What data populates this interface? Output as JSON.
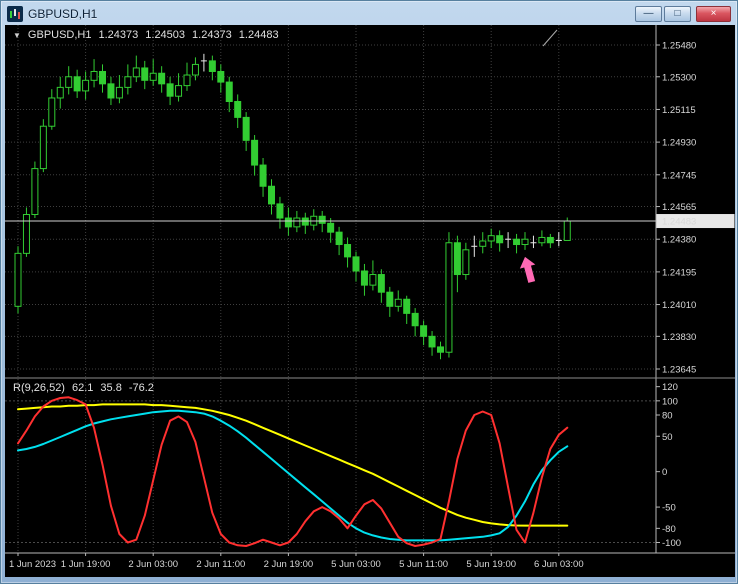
{
  "window": {
    "title": "GBPUSD,H1",
    "controls": {
      "minimize_glyph": "—",
      "maximize_glyph": "□",
      "close_glyph": "×"
    }
  },
  "icons": {
    "app_icon": "candlestick-chart-icon",
    "dropdown_marker": "▼"
  },
  "chart_header": {
    "symbol": "GBPUSD,H1",
    "open": "1.24373",
    "high": "1.24503",
    "low": "1.24373",
    "close": "1.24483"
  },
  "indicator_header": {
    "name": "R(9,26,52)",
    "v1": "62.1",
    "v2": "35.8",
    "v3": "-76.2"
  },
  "colors": {
    "background": "#000000",
    "grid": "#3f3f3f",
    "axis": "#b8b8b8",
    "text": "#d8d8d8",
    "candle": "#32CD32",
    "doji": "#e8e8e8",
    "bid_line": "#d0d0d0",
    "bid_tag_bg": "#e8e8e8",
    "red_line": "#ff3030",
    "cyan_line": "#00e0ee",
    "yellow_line": "#ffff00",
    "arrow": "#ff69b4",
    "titlebar": "#a9c7e2",
    "close_button": "#bf3642"
  },
  "chart_data": {
    "type": "candlestick",
    "symbol": "GBPUSD",
    "timeframe": "H1",
    "price_axis": {
      "ticks": [
        "1.25480",
        "1.25300",
        "1.25115",
        "1.24930",
        "1.24745",
        "1.24565",
        "1.24380",
        "1.24195",
        "1.24010",
        "1.23830",
        "1.23645"
      ],
      "current": "1.24483"
    },
    "time_axis": {
      "labels": [
        "1 Jun 2023",
        "1 Jun 19:00",
        "2 Jun 03:00",
        "2 Jun 11:00",
        "2 Jun 19:00",
        "5 Jun 03:00",
        "5 Jun 11:00",
        "5 Jun 19:00",
        "6 Jun 03:00"
      ],
      "bar_indices": [
        0,
        8,
        16,
        24,
        32,
        40,
        48,
        56,
        64
      ]
    },
    "candles": [
      [
        1.24,
        1.2434,
        1.2396,
        1.243
      ],
      [
        1.243,
        1.2456,
        1.2428,
        1.2452
      ],
      [
        1.2452,
        1.2482,
        1.245,
        1.2478
      ],
      [
        1.2478,
        1.2506,
        1.2476,
        1.2502
      ],
      [
        1.2502,
        1.2523,
        1.25,
        1.2518
      ],
      [
        1.2518,
        1.253,
        1.2512,
        1.2524
      ],
      [
        1.2524,
        1.2536,
        1.252,
        1.253
      ],
      [
        1.253,
        1.2534,
        1.2518,
        1.2522
      ],
      [
        1.2522,
        1.2533,
        1.2517,
        1.2528
      ],
      [
        1.2528,
        1.254,
        1.2524,
        1.2533
      ],
      [
        1.2533,
        1.2537,
        1.2521,
        1.2526
      ],
      [
        1.2526,
        1.253,
        1.2514,
        1.2518
      ],
      [
        1.2518,
        1.2531,
        1.2515,
        1.2524
      ],
      [
        1.2524,
        1.2537,
        1.252,
        1.253
      ],
      [
        1.253,
        1.2542,
        1.2527,
        1.2535
      ],
      [
        1.2535,
        1.2539,
        1.2523,
        1.2528
      ],
      [
        1.2528,
        1.254,
        1.2525,
        1.2532
      ],
      [
        1.2532,
        1.2536,
        1.2521,
        1.2526
      ],
      [
        1.2526,
        1.253,
        1.2514,
        1.2519
      ],
      [
        1.2519,
        1.2532,
        1.2516,
        1.2525
      ],
      [
        1.2525,
        1.2538,
        1.2522,
        1.2531
      ],
      [
        1.2531,
        1.2541,
        1.2528,
        1.2537
      ],
      [
        1.2537,
        1.2543,
        1.2533,
        1.2539
      ],
      [
        1.2539,
        1.2542,
        1.2528,
        1.2533
      ],
      [
        1.2533,
        1.2537,
        1.2521,
        1.2527
      ],
      [
        1.2527,
        1.253,
        1.251,
        1.2516
      ],
      [
        1.2516,
        1.252,
        1.2501,
        1.2507
      ],
      [
        1.2507,
        1.251,
        1.2488,
        1.2494
      ],
      [
        1.2494,
        1.2497,
        1.2474,
        1.248
      ],
      [
        1.248,
        1.2484,
        1.2462,
        1.2468
      ],
      [
        1.2468,
        1.2472,
        1.2452,
        1.2458
      ],
      [
        1.2458,
        1.2462,
        1.2444,
        1.245
      ],
      [
        1.245,
        1.2456,
        1.244,
        1.2445
      ],
      [
        1.2445,
        1.2454,
        1.2442,
        1.245
      ],
      [
        1.245,
        1.2453,
        1.2441,
        1.2446
      ],
      [
        1.2446,
        1.2455,
        1.2443,
        1.2451
      ],
      [
        1.2451,
        1.2454,
        1.2442,
        1.2447
      ],
      [
        1.2447,
        1.245,
        1.2436,
        1.2442
      ],
      [
        1.2442,
        1.2445,
        1.2429,
        1.2435
      ],
      [
        1.2435,
        1.2439,
        1.2422,
        1.2428
      ],
      [
        1.2428,
        1.2431,
        1.2414,
        1.242
      ],
      [
        1.242,
        1.2424,
        1.2406,
        1.2412
      ],
      [
        1.2412,
        1.2426,
        1.2409,
        1.2418
      ],
      [
        1.2418,
        1.2421,
        1.2402,
        1.2408
      ],
      [
        1.2408,
        1.2411,
        1.2394,
        1.24
      ],
      [
        1.24,
        1.2409,
        1.2397,
        1.2404
      ],
      [
        1.2404,
        1.2406,
        1.239,
        1.2396
      ],
      [
        1.2396,
        1.2399,
        1.2383,
        1.2389
      ],
      [
        1.2389,
        1.2392,
        1.2378,
        1.2383
      ],
      [
        1.2383,
        1.2386,
        1.2372,
        1.2377
      ],
      [
        1.2377,
        1.238,
        1.237,
        1.2374
      ],
      [
        1.2374,
        1.2442,
        1.2371,
        1.2436
      ],
      [
        1.2436,
        1.244,
        1.2408,
        1.2418
      ],
      [
        1.2418,
        1.2436,
        1.2415,
        1.2432
      ],
      [
        1.2432,
        1.244,
        1.2428,
        1.2434
      ],
      [
        1.2434,
        1.2442,
        1.243,
        1.2437
      ],
      [
        1.2437,
        1.2444,
        1.2433,
        1.244
      ],
      [
        1.244,
        1.2443,
        1.2431,
        1.2436
      ],
      [
        1.2436,
        1.2442,
        1.2433,
        1.2438
      ],
      [
        1.2438,
        1.2441,
        1.243,
        1.2435
      ],
      [
        1.2435,
        1.2442,
        1.2432,
        1.2438
      ],
      [
        1.2438,
        1.244,
        1.2433,
        1.2436
      ],
      [
        1.2436,
        1.2443,
        1.2434,
        1.2439
      ],
      [
        1.2439,
        1.2441,
        1.2433,
        1.2436
      ],
      [
        1.2436,
        1.2442,
        1.2434,
        1.24373
      ],
      [
        1.24373,
        1.24503,
        1.24373,
        1.24483
      ]
    ],
    "indicator": {
      "name": "R(9,26,52)",
      "last_values": [
        62.1,
        35.8,
        -76.2
      ],
      "ticks": [
        "120",
        "100",
        "80",
        "50",
        "0",
        "-50",
        "-80",
        "-100"
      ],
      "levels": [
        100,
        -100
      ],
      "series": [
        {
          "name": "fast",
          "color": "#ff3030",
          "values": [
            40,
            58,
            78,
            92,
            100,
            104,
            105,
            101,
            95,
            62,
            10,
            -48,
            -88,
            -100,
            -96,
            -62,
            -12,
            38,
            72,
            78,
            70,
            42,
            -8,
            -58,
            -88,
            -100,
            -104,
            -105,
            -101,
            -96,
            -100,
            -104,
            -100,
            -88,
            -70,
            -56,
            -50,
            -56,
            -66,
            -80,
            -62,
            -46,
            -40,
            -52,
            -72,
            -92,
            -101,
            -105,
            -103,
            -100,
            -95,
            -42,
            18,
            58,
            80,
            85,
            80,
            40,
            -22,
            -82,
            -100,
            -58,
            -8,
            32,
            52,
            62.1
          ]
        },
        {
          "name": "mid",
          "color": "#00e0ee",
          "values": [
            30,
            32,
            35,
            39,
            44,
            49,
            54,
            59,
            64,
            68,
            71,
            74,
            76,
            78,
            80,
            82,
            84,
            85,
            86,
            86,
            85,
            84,
            82,
            78,
            72,
            65,
            57,
            48,
            38,
            28,
            18,
            8,
            -2,
            -12,
            -22,
            -32,
            -42,
            -52,
            -62,
            -72,
            -80,
            -86,
            -90,
            -93,
            -95,
            -96,
            -97,
            -97,
            -97,
            -97,
            -97,
            -96,
            -95,
            -94,
            -93,
            -92,
            -90,
            -87,
            -78,
            -62,
            -42,
            -18,
            2,
            16,
            28,
            35.8
          ]
        },
        {
          "name": "slow",
          "color": "#ffff00",
          "values": [
            88,
            89,
            90,
            91,
            92,
            92,
            93,
            93,
            94,
            94,
            95,
            95,
            95,
            95,
            95,
            95,
            94,
            94,
            93,
            92,
            91,
            90,
            88,
            86,
            83,
            80,
            76,
            72,
            67,
            62,
            57,
            52,
            47,
            42,
            37,
            32,
            27,
            22,
            17,
            12,
            7,
            2,
            -3,
            -9,
            -15,
            -21,
            -27,
            -33,
            -39,
            -45,
            -51,
            -56,
            -61,
            -65,
            -68,
            -71,
            -73,
            -74.5,
            -75.5,
            -76,
            -76.2,
            -76.2,
            -76.2,
            -76.2,
            -76.2,
            -76.2
          ]
        }
      ]
    },
    "arrow": {
      "bar": 60,
      "price": 1.2428,
      "color": "#ff69b4"
    }
  }
}
